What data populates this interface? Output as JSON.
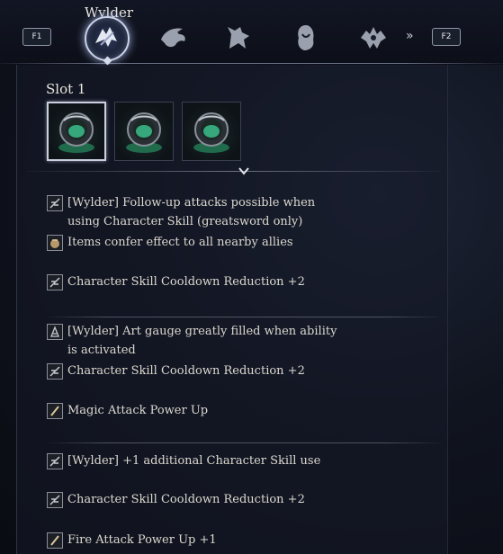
{
  "header": {
    "hero_name": "Wylder",
    "prev_key": "F1",
    "next_key": "F2",
    "more_glyph": "»",
    "tabs": [
      {
        "icon": "wylder-icon",
        "selected": true
      },
      {
        "icon": "eagle-icon",
        "selected": false
      },
      {
        "icon": "wolf-icon",
        "selected": false
      },
      {
        "icon": "hooded-figure-icon",
        "selected": false
      },
      {
        "icon": "dragon-crest-icon",
        "selected": false
      }
    ]
  },
  "slot": {
    "title": "Slot 1",
    "relics": [
      {
        "icon": "relic-chalice-icon",
        "selected": true
      },
      {
        "icon": "relic-chalice-icon",
        "selected": false
      },
      {
        "icon": "relic-chalice-icon",
        "selected": false
      }
    ]
  },
  "effects": [
    {
      "icon": "skill-icon",
      "text": "[Wylder] Follow-up attacks possible when using Character Skill (greatsword only)"
    },
    {
      "icon": "item-pouch-icon",
      "text": "Items confer effect to all nearby allies"
    },
    {
      "icon": "skill-icon",
      "text": "Character Skill Cooldown Reduction +2"
    },
    {
      "icon": "art-gauge-icon",
      "text": "[Wylder] Art gauge greatly filled when ability is activated"
    },
    {
      "icon": "skill-icon",
      "text": "Character Skill Cooldown Reduction +2"
    },
    {
      "icon": "staff-icon",
      "text": "Magic Attack Power Up"
    },
    {
      "icon": "skill-icon",
      "text": "[Wylder] +1 additional Character Skill use"
    },
    {
      "icon": "skill-icon",
      "text": "Character Skill Cooldown Reduction +2"
    },
    {
      "icon": "staff-icon",
      "text": "Fire Attack Power Up +1"
    }
  ],
  "colors": {
    "text": "#dcd9d0",
    "accent": "#c9d3ea",
    "relic_glow": "#3fd39a"
  }
}
